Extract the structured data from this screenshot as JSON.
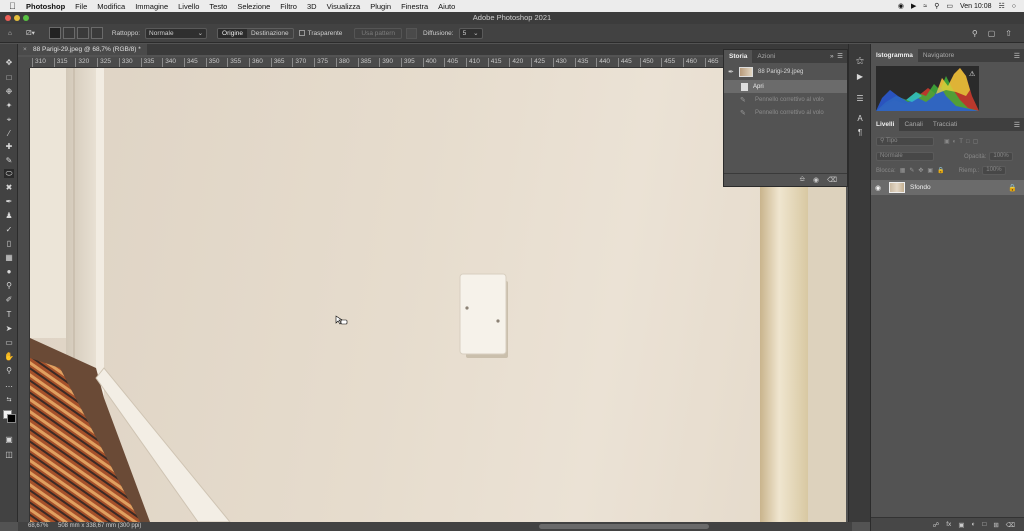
{
  "menubar": {
    "app": "Photoshop",
    "items": [
      "File",
      "Modifica",
      "Immagine",
      "Livello",
      "Testo",
      "Selezione",
      "Filtro",
      "3D",
      "Visualizza",
      "Plugin",
      "Finestra",
      "Aiuto"
    ],
    "clock": "Ven 10:08"
  },
  "window": {
    "title": "Adobe Photoshop 2021"
  },
  "options": {
    "rapporto_label": "Rattoppo:",
    "rapporto_value": "Normale",
    "origine": "Origine",
    "destinazione": "Destinazione",
    "trasparente": "Trasparente",
    "usa_pattern": "Usa pattern",
    "diffusione_label": "Diffusione:",
    "diffusione_value": "5"
  },
  "document": {
    "tab_title": "88 Parigi-29.jpeg @ 68,7% (RGB/8) *",
    "close_symbol": "×",
    "zoom": "68,67%",
    "doc_info": "508 mm x 338,67 mm (300 ppi)",
    "ruler_ticks": [
      "310",
      "315",
      "320",
      "325",
      "330",
      "335",
      "340",
      "345",
      "350",
      "355",
      "360",
      "365",
      "370",
      "375",
      "380",
      "385",
      "390",
      "395",
      "400",
      "405",
      "410",
      "415",
      "420",
      "425",
      "430",
      "435",
      "440",
      "445",
      "450",
      "455",
      "460",
      "465"
    ]
  },
  "storia_panel": {
    "tab_active": "Storia",
    "tab_other": "Azioni",
    "snapshot": "88 Parigi-29.jpeg",
    "states": [
      "Apri",
      "Pennello correttivo al volo",
      "Pennello correttivo al volo"
    ]
  },
  "histogram_panel": {
    "tab_active": "Istogramma",
    "tab_other": "Navigatore"
  },
  "layers_panel": {
    "tabs": [
      "Livelli",
      "Canali",
      "Tracciati"
    ],
    "filter_placeholder": "Tipo",
    "blend_mode": "Normale",
    "opacity_label": "Opacità:",
    "opacity_value": "100%",
    "lock_label": "Blocca:",
    "fill_label": "Riemp.:",
    "fill_value": "100%",
    "layer_name": "Sfondo"
  },
  "colors": {
    "accent_selected": "#6b6b6b",
    "panel_bg": "#535353",
    "wall": "#e6dccd"
  }
}
